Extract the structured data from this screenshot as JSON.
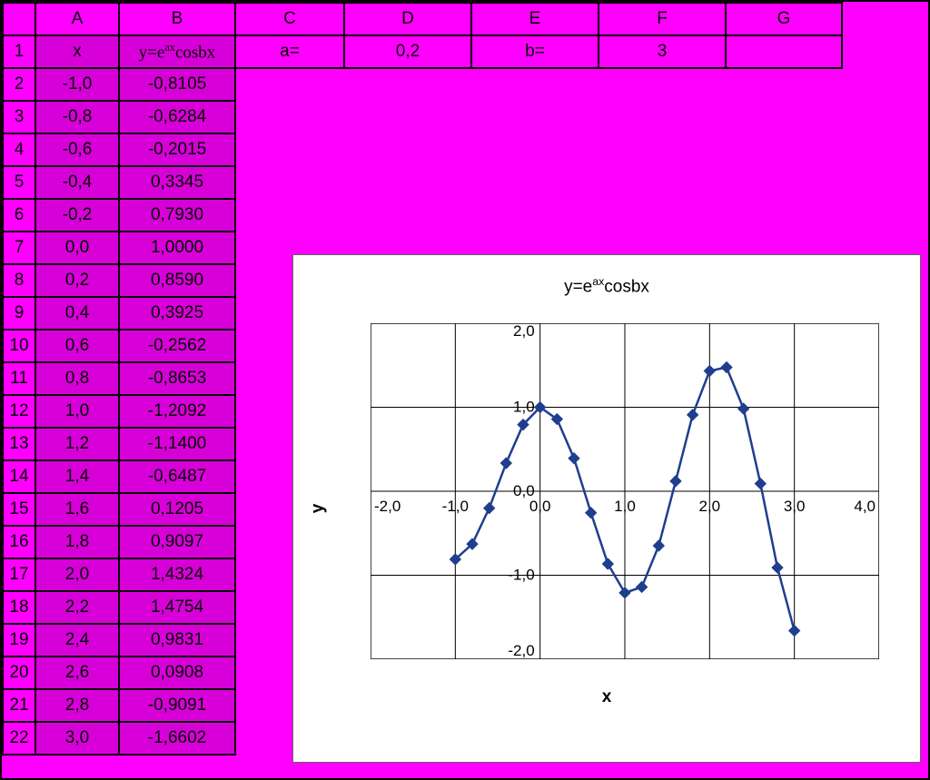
{
  "columns": [
    "A",
    "B",
    "C",
    "D",
    "E",
    "F",
    "G"
  ],
  "row1": {
    "A": "x",
    "B_html": "y=e<sup>ax</sup>cosbx",
    "C": "a=",
    "D": "0,2",
    "E": "b=",
    "F": "3",
    "G": ""
  },
  "rows": [
    {
      "n": "2",
      "A": "-1,0",
      "B": "-0,8105"
    },
    {
      "n": "3",
      "A": "-0,8",
      "B": "-0,6284"
    },
    {
      "n": "4",
      "A": "-0,6",
      "B": "-0,2015"
    },
    {
      "n": "5",
      "A": "-0,4",
      "B": "0,3345"
    },
    {
      "n": "6",
      "A": "-0,2",
      "B": "0,7930"
    },
    {
      "n": "7",
      "A": "0,0",
      "B": "1,0000"
    },
    {
      "n": "8",
      "A": "0,2",
      "B": "0,8590"
    },
    {
      "n": "9",
      "A": "0,4",
      "B": "0,3925"
    },
    {
      "n": "10",
      "A": "0,6",
      "B": "-0,2562"
    },
    {
      "n": "11",
      "A": "0,8",
      "B": "-0,8653"
    },
    {
      "n": "12",
      "A": "1,0",
      "B": "-1,2092"
    },
    {
      "n": "13",
      "A": "1,2",
      "B": "-1,1400"
    },
    {
      "n": "14",
      "A": "1,4",
      "B": "-0,6487"
    },
    {
      "n": "15",
      "A": "1,6",
      "B": "0,1205"
    },
    {
      "n": "16",
      "A": "1,8",
      "B": "0,9097"
    },
    {
      "n": "17",
      "A": "2,0",
      "B": "1,4324"
    },
    {
      "n": "18",
      "A": "2,2",
      "B": "1,4754"
    },
    {
      "n": "19",
      "A": "2,4",
      "B": "0,9831"
    },
    {
      "n": "20",
      "A": "2,6",
      "B": "0,0908"
    },
    {
      "n": "21",
      "A": "2,8",
      "B": "-0,9091"
    },
    {
      "n": "22",
      "A": "3,0",
      "B": "-1,6602"
    }
  ],
  "chart_data": {
    "type": "line",
    "title_html": "y=e<sup>ax</sup>cosbx",
    "xlabel": "x",
    "ylabel": "y",
    "xlim": [
      -2,
      4
    ],
    "ylim": [
      -2,
      2
    ],
    "xticks": [
      -2,
      -1,
      0,
      1,
      2,
      3,
      4
    ],
    "yticks": [
      -2,
      -1,
      0,
      1,
      2
    ],
    "xtick_labels": [
      "-2,0",
      "-1,0",
      "0,0",
      "1,0",
      "2,0",
      "3,0",
      "4,0"
    ],
    "ytick_labels": [
      "-2,0",
      "-1,0",
      "0,0",
      "1,0",
      "2,0"
    ],
    "series": [
      {
        "name": "y",
        "x": [
          -1.0,
          -0.8,
          -0.6,
          -0.4,
          -0.2,
          0.0,
          0.2,
          0.4,
          0.6,
          0.8,
          1.0,
          1.2,
          1.4,
          1.6,
          1.8,
          2.0,
          2.2,
          2.4,
          2.6,
          2.8,
          3.0
        ],
        "y": [
          -0.8105,
          -0.6284,
          -0.2015,
          0.3345,
          0.793,
          1.0,
          0.859,
          0.3925,
          -0.2562,
          -0.8653,
          -1.2092,
          -1.14,
          -0.6487,
          0.1205,
          0.9097,
          1.4324,
          1.4754,
          0.9831,
          0.0908,
          -0.9091,
          -1.6602
        ]
      }
    ],
    "marker": "diamond",
    "line_color": "#1f3e8f"
  }
}
